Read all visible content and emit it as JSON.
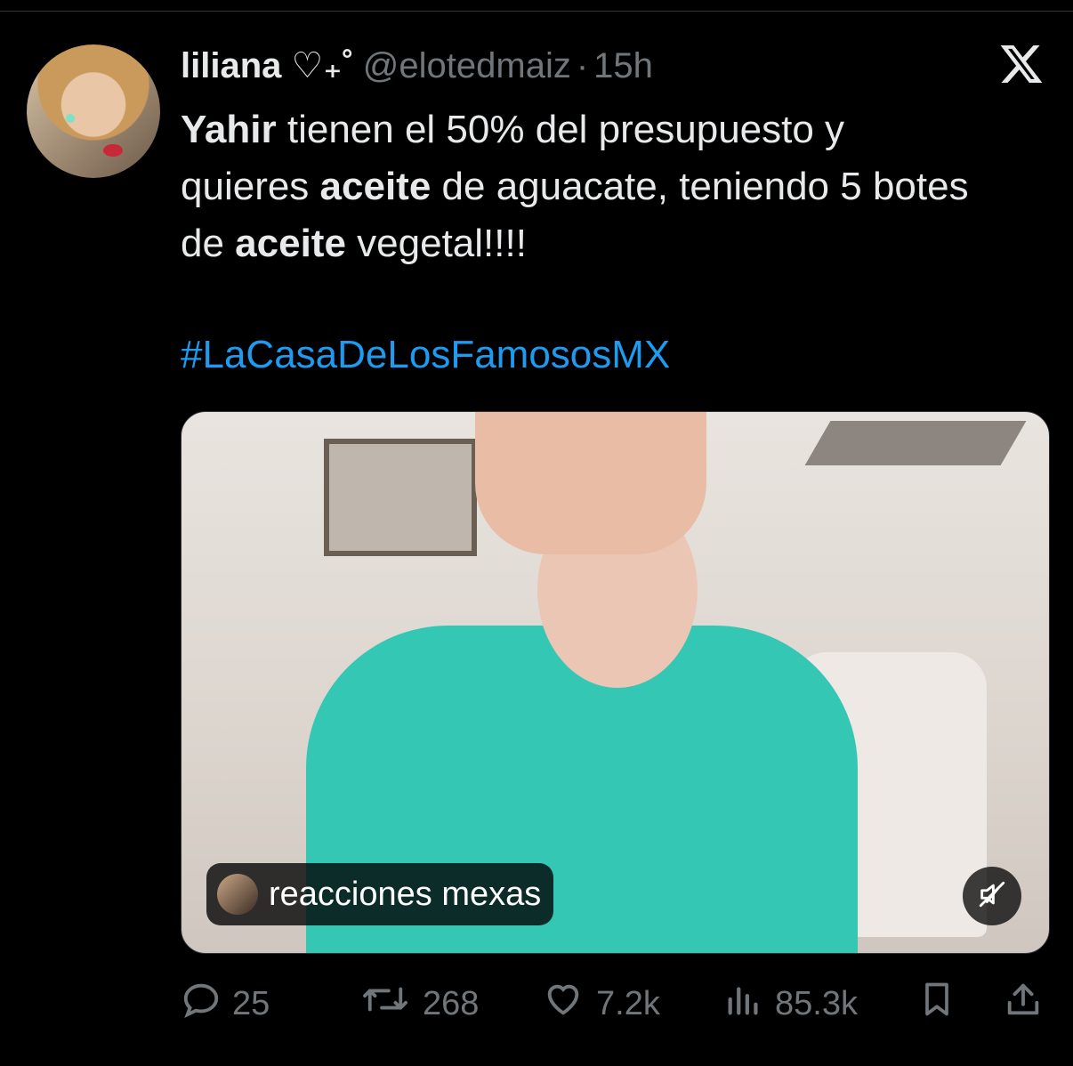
{
  "tweet": {
    "author_name": "liliana ♡₊˚",
    "handle": "@elotedmaiz",
    "separator": "·",
    "time": "15h",
    "text_parts": [
      {
        "t": "Yahir",
        "bold": true
      },
      {
        "t": " tienen el 50% del presupuesto y quieres ",
        "bold": false
      },
      {
        "t": "aceite",
        "bold": true
      },
      {
        "t": " de aguacate, teniendo 5 botes de ",
        "bold": false
      },
      {
        "t": "aceite",
        "bold": true
      },
      {
        "t": " vegetal!!!!",
        "bold": false
      }
    ],
    "hashtag": "#LaCasaDeLosFamososMX",
    "media": {
      "source_label": "reacciones mexas"
    },
    "stats": {
      "replies": "25",
      "retweets": "268",
      "likes": "7.2k",
      "views": "85.3k"
    }
  },
  "colors": {
    "background": "#000000",
    "text": "#e7e9ea",
    "muted": "#71767b",
    "link": "#1d9bf0"
  },
  "icons": [
    "x-logo-icon",
    "mute-icon",
    "reply-icon",
    "retweet-icon",
    "like-icon",
    "views-icon",
    "bookmark-icon",
    "share-icon"
  ]
}
